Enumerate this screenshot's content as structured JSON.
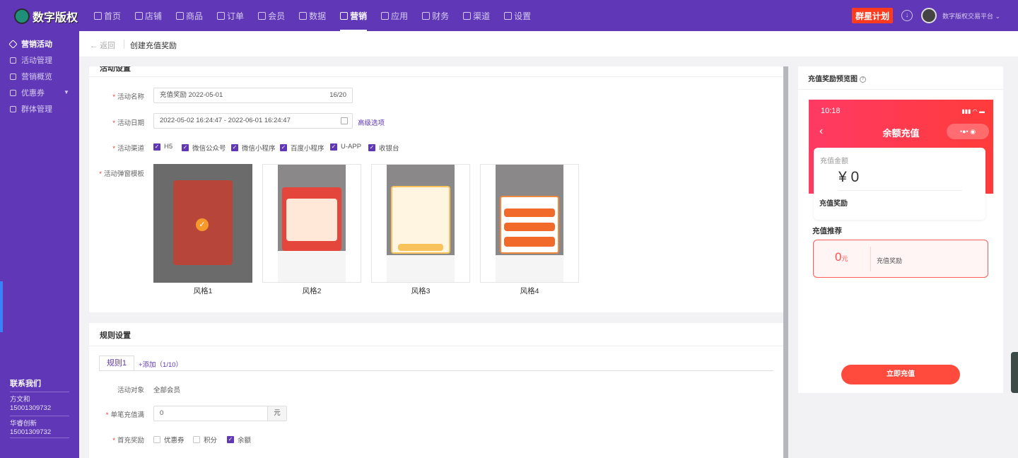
{
  "app": {
    "logo_text": "数字版权"
  },
  "nav": [
    {
      "label": "首页"
    },
    {
      "label": "店铺"
    },
    {
      "label": "商品"
    },
    {
      "label": "订单"
    },
    {
      "label": "会员"
    },
    {
      "label": "数据"
    },
    {
      "label": "营销"
    },
    {
      "label": "应用"
    },
    {
      "label": "财务"
    },
    {
      "label": "渠道"
    },
    {
      "label": "设置"
    }
  ],
  "nav_active": "营销",
  "header": {
    "plan_button": "群星计划",
    "user_name": "数字版权交易平台"
  },
  "sidebar": {
    "items": [
      {
        "label": "营销活动"
      },
      {
        "label": "活动管理"
      },
      {
        "label": "营销概览"
      },
      {
        "label": "优惠券"
      },
      {
        "label": "群体管理"
      }
    ],
    "contact_title": "联系我们",
    "contacts": [
      {
        "name": "方文和",
        "phone": "15001309732"
      },
      {
        "name": "华睿创新",
        "phone": "15001309732"
      }
    ]
  },
  "breadcrumb": {
    "back": "返回",
    "current": "创建充值奖励"
  },
  "form": {
    "section_title": "活动设置",
    "name_label": "活动名称",
    "name_value": "充值奖励  2022-05-01",
    "name_counter": "16/20",
    "date_label": "活动日期",
    "date_value": "2022-05-02 16:24:47 - 2022-06-01 16:24:47",
    "advanced_link": "高级选项",
    "channel_label": "活动渠道",
    "channels": [
      {
        "label": "H5",
        "checked": true
      },
      {
        "label": "微信公众号",
        "checked": true
      },
      {
        "label": "微信小程序",
        "checked": true
      },
      {
        "label": "百度小程序",
        "checked": true
      },
      {
        "label": "U-APP",
        "checked": true
      },
      {
        "label": "收银台",
        "checked": true
      }
    ],
    "template_label": "活动弹窗模板",
    "templates": [
      {
        "label": "风格1",
        "selected": true
      },
      {
        "label": "风格2",
        "selected": false
      },
      {
        "label": "风格3",
        "selected": false
      },
      {
        "label": "风格4",
        "selected": false
      }
    ]
  },
  "rules": {
    "section_title": "规则设置",
    "tab": "规则1",
    "add_link": "+添加（1/10）",
    "target_label": "活动对象",
    "target_value": "全部会员",
    "threshold_label": "单笔充值满",
    "threshold_value": "0",
    "threshold_unit": "元",
    "reward_label": "首充奖励",
    "reward_options": [
      {
        "label": "优惠券",
        "checked": false
      },
      {
        "label": "积分",
        "checked": false
      },
      {
        "label": "余额",
        "checked": true
      }
    ]
  },
  "preview": {
    "title": "充值奖励预览图",
    "time": "10:18",
    "page_title": "余额充值",
    "amount_label": "充值金额",
    "amount_value": "¥ 0",
    "reward_label": "充值奖励",
    "recommend_title": "充值推荐",
    "recommend_amount": "0",
    "recommend_unit": "元",
    "recommend_label": "充值奖励",
    "button": "立即充值"
  }
}
